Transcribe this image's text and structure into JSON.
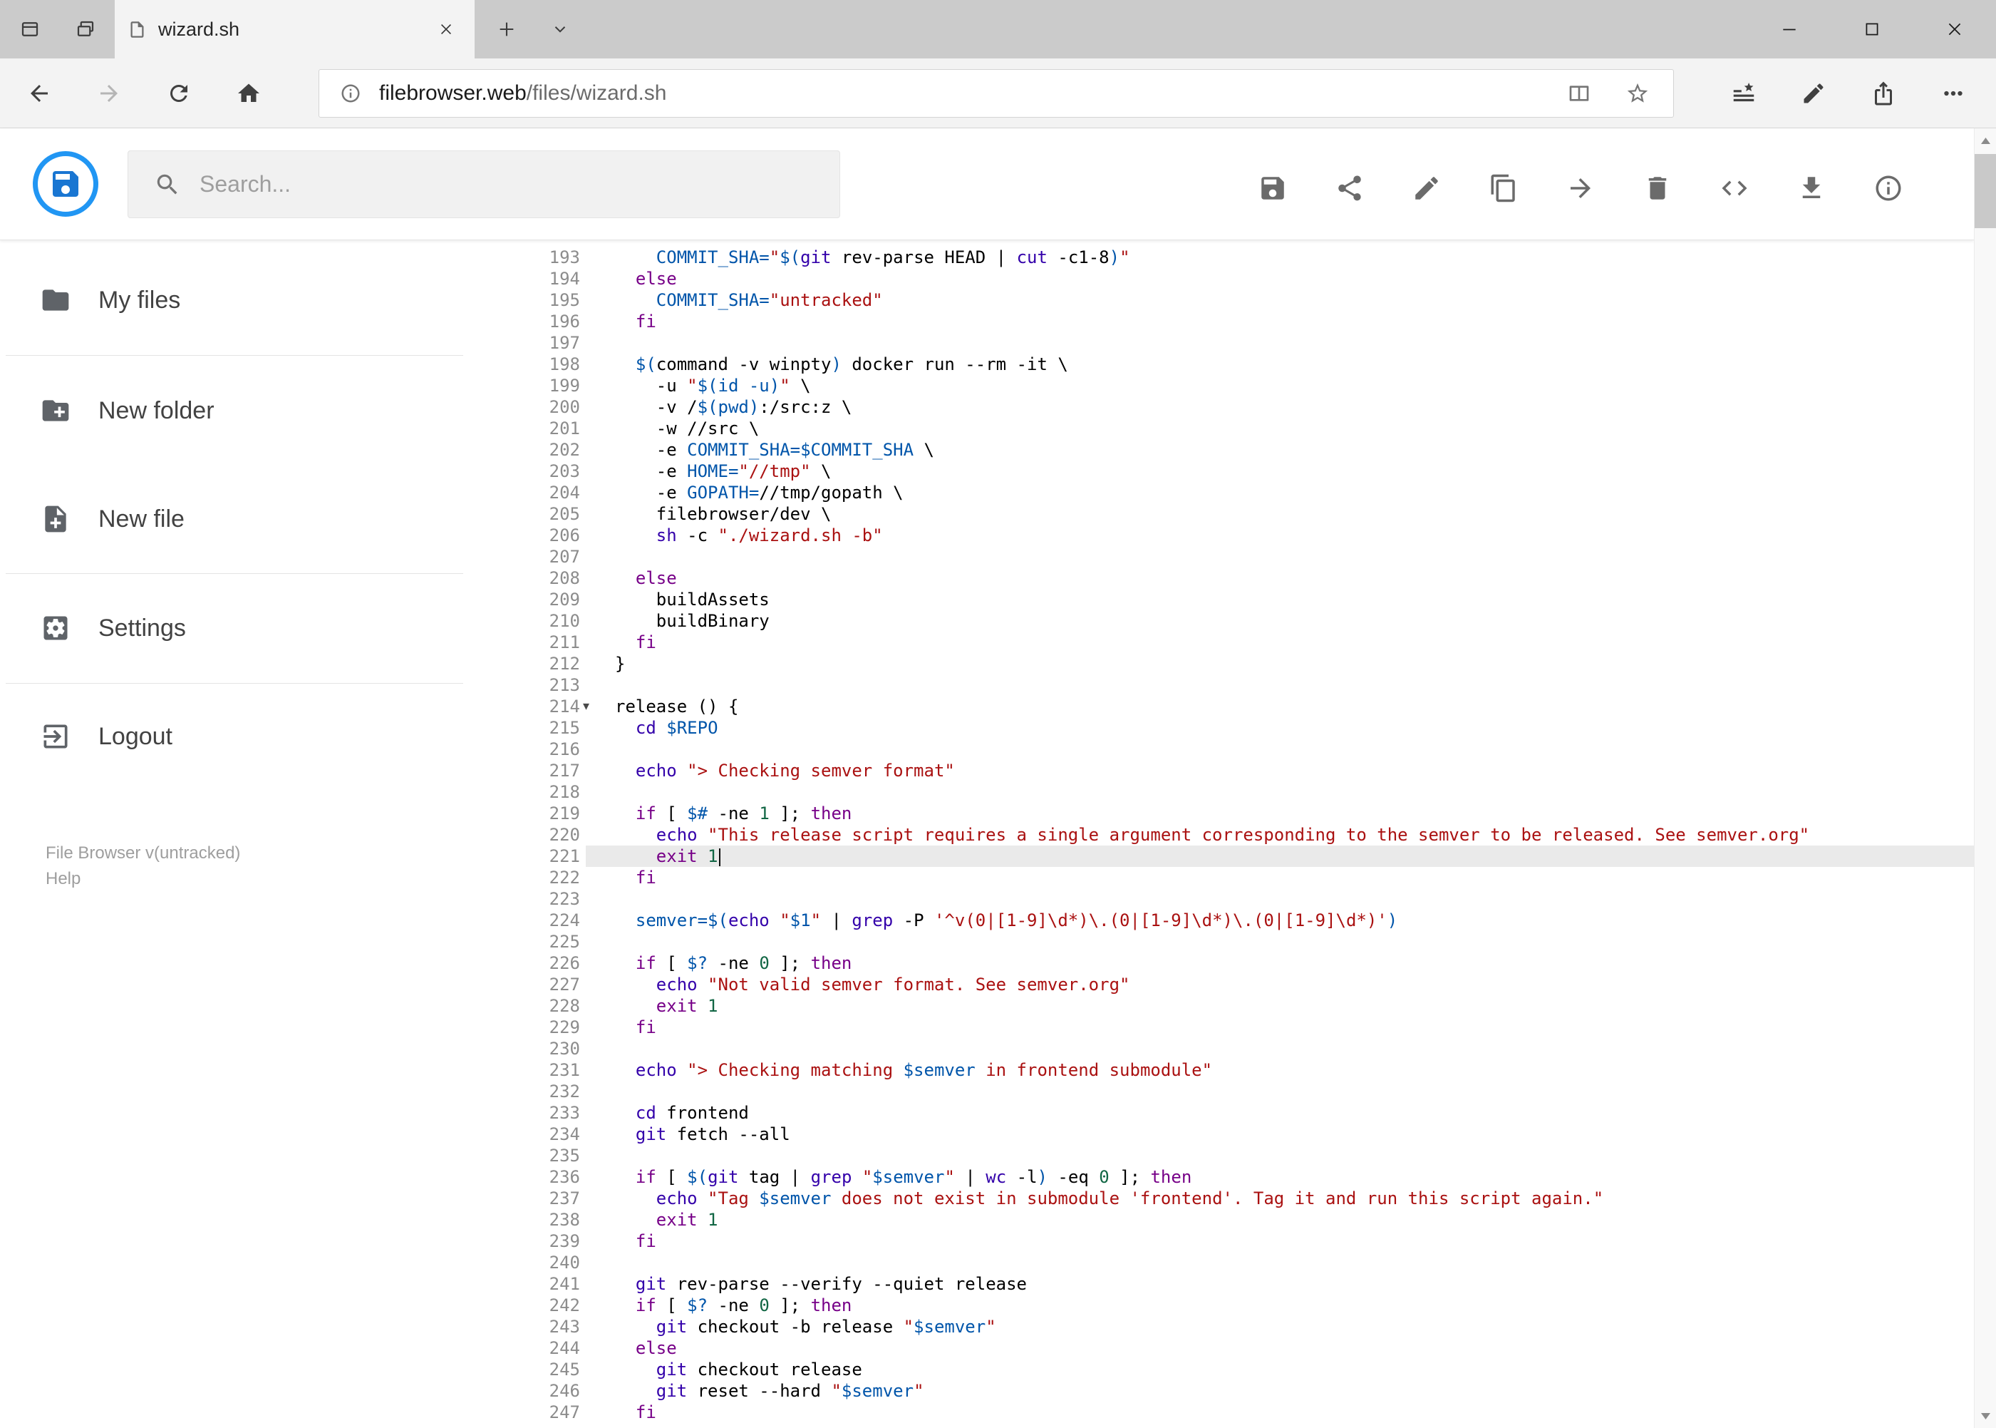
{
  "browser": {
    "tab_title": "wizard.sh",
    "url": {
      "host": "filebrowser.web",
      "path": "/files/wizard.sh"
    },
    "window_control_icons": [
      "minimize",
      "maximize",
      "close"
    ],
    "nav_icons": [
      "back",
      "forward",
      "refresh",
      "home"
    ],
    "urlbox_icons": [
      "site-info",
      "reading-view",
      "favorite-star"
    ],
    "action_icons": [
      "hub",
      "notes-pen",
      "share",
      "more-ellipsis"
    ]
  },
  "app": {
    "search_placeholder": "Search...",
    "toolbar_icons": [
      "save",
      "share",
      "rename",
      "copy",
      "move",
      "delete",
      "code",
      "download",
      "info"
    ],
    "accent_color": "#2196f3",
    "sidebar": {
      "items": [
        {
          "label": "My files",
          "icon": "folder"
        },
        {
          "label": "New folder",
          "icon": "create-new-folder"
        },
        {
          "label": "New file",
          "icon": "note-add"
        },
        {
          "label": "Settings",
          "icon": "settings"
        },
        {
          "label": "Logout",
          "icon": "logout"
        }
      ],
      "footer": {
        "version": "File Browser v(untracked)",
        "help": "Help"
      }
    }
  },
  "editor": {
    "first_line": 193,
    "active_line": 221,
    "fold_marker_line": 214,
    "fold_glyph": "▾",
    "palette": {
      "pl": "#000000",
      "kw": "#770088",
      "bi": "#3300aa",
      "st": "#aa1111",
      "va": "#0055aa",
      "nu": "#116644"
    },
    "lines": [
      [
        [
          "pl",
          "    "
        ],
        [
          "va",
          "COMMIT_SHA="
        ],
        [
          "st",
          "\""
        ],
        [
          "va",
          "$("
        ],
        [
          "bi",
          "git"
        ],
        [
          "pl",
          " rev-parse HEAD | "
        ],
        [
          "bi",
          "cut"
        ],
        [
          "pl",
          " -c1-8"
        ],
        [
          "va",
          ")"
        ],
        [
          "st",
          "\""
        ]
      ],
      [
        [
          "pl",
          "  "
        ],
        [
          "kw",
          "else"
        ]
      ],
      [
        [
          "pl",
          "    "
        ],
        [
          "va",
          "COMMIT_SHA="
        ],
        [
          "st",
          "\"untracked\""
        ]
      ],
      [
        [
          "pl",
          "  "
        ],
        [
          "kw",
          "fi"
        ]
      ],
      [],
      [
        [
          "pl",
          "  "
        ],
        [
          "va",
          "$("
        ],
        [
          "pl",
          "command -v winpty"
        ],
        [
          "va",
          ")"
        ],
        [
          "pl",
          " docker run --rm -it \\"
        ]
      ],
      [
        [
          "pl",
          "    -u "
        ],
        [
          "st",
          "\""
        ],
        [
          "va",
          "$(id -u)"
        ],
        [
          "st",
          "\""
        ],
        [
          "pl",
          " \\"
        ]
      ],
      [
        [
          "pl",
          "    -v /"
        ],
        [
          "va",
          "$(pwd)"
        ],
        [
          "pl",
          ":/src:z \\"
        ]
      ],
      [
        [
          "pl",
          "    -w //src \\"
        ]
      ],
      [
        [
          "pl",
          "    -e "
        ],
        [
          "va",
          "COMMIT_SHA=$COMMIT_SHA"
        ],
        [
          "pl",
          " \\"
        ]
      ],
      [
        [
          "pl",
          "    -e "
        ],
        [
          "va",
          "HOME="
        ],
        [
          "st",
          "\"//tmp\""
        ],
        [
          "pl",
          " \\"
        ]
      ],
      [
        [
          "pl",
          "    -e "
        ],
        [
          "va",
          "GOPATH="
        ],
        [
          "pl",
          "//tmp/gopath \\"
        ]
      ],
      [
        [
          "pl",
          "    filebrowser/dev \\"
        ]
      ],
      [
        [
          "pl",
          "    "
        ],
        [
          "bi",
          "sh"
        ],
        [
          "pl",
          " -c "
        ],
        [
          "st",
          "\"./wizard.sh -b\""
        ]
      ],
      [],
      [
        [
          "pl",
          "  "
        ],
        [
          "kw",
          "else"
        ]
      ],
      [
        [
          "pl",
          "    buildAssets"
        ]
      ],
      [
        [
          "pl",
          "    buildBinary"
        ]
      ],
      [
        [
          "pl",
          "  "
        ],
        [
          "kw",
          "fi"
        ]
      ],
      [
        [
          "pl",
          "}"
        ]
      ],
      [],
      [
        [
          "pl",
          "release () {"
        ]
      ],
      [
        [
          "pl",
          "  "
        ],
        [
          "bi",
          "cd"
        ],
        [
          "pl",
          " "
        ],
        [
          "va",
          "$REPO"
        ]
      ],
      [],
      [
        [
          "pl",
          "  "
        ],
        [
          "bi",
          "echo"
        ],
        [
          "pl",
          " "
        ],
        [
          "st",
          "\"> Checking semver format\""
        ]
      ],
      [],
      [
        [
          "pl",
          "  "
        ],
        [
          "kw",
          "if"
        ],
        [
          "pl",
          " [ "
        ],
        [
          "va",
          "$#"
        ],
        [
          "pl",
          " -ne "
        ],
        [
          "nu",
          "1"
        ],
        [
          "pl",
          " ]; "
        ],
        [
          "kw",
          "then"
        ]
      ],
      [
        [
          "pl",
          "    "
        ],
        [
          "bi",
          "echo"
        ],
        [
          "pl",
          " "
        ],
        [
          "st",
          "\"This release script requires a single argument corresponding to the semver to be released. See semver.org\""
        ]
      ],
      [
        [
          "pl",
          "    "
        ],
        [
          "kw",
          "exit"
        ],
        [
          "pl",
          " "
        ],
        [
          "nu",
          "1"
        ]
      ],
      [
        [
          "pl",
          "  "
        ],
        [
          "kw",
          "fi"
        ]
      ],
      [],
      [
        [
          "pl",
          "  "
        ],
        [
          "va",
          "semver=$("
        ],
        [
          "bi",
          "echo"
        ],
        [
          "pl",
          " "
        ],
        [
          "st",
          "\""
        ],
        [
          "va",
          "$1"
        ],
        [
          "st",
          "\""
        ],
        [
          "pl",
          " | "
        ],
        [
          "bi",
          "grep"
        ],
        [
          "pl",
          " -P "
        ],
        [
          "st",
          "'^v(0|[1-9]\\d*)\\.(0|[1-9]\\d*)\\.(0|[1-9]\\d*)'"
        ],
        [
          "va",
          ")"
        ]
      ],
      [],
      [
        [
          "pl",
          "  "
        ],
        [
          "kw",
          "if"
        ],
        [
          "pl",
          " [ "
        ],
        [
          "va",
          "$?"
        ],
        [
          "pl",
          " -ne "
        ],
        [
          "nu",
          "0"
        ],
        [
          "pl",
          " ]; "
        ],
        [
          "kw",
          "then"
        ]
      ],
      [
        [
          "pl",
          "    "
        ],
        [
          "bi",
          "echo"
        ],
        [
          "pl",
          " "
        ],
        [
          "st",
          "\"Not valid semver format. See semver.org\""
        ]
      ],
      [
        [
          "pl",
          "    "
        ],
        [
          "kw",
          "exit"
        ],
        [
          "pl",
          " "
        ],
        [
          "nu",
          "1"
        ]
      ],
      [
        [
          "pl",
          "  "
        ],
        [
          "kw",
          "fi"
        ]
      ],
      [],
      [
        [
          "pl",
          "  "
        ],
        [
          "bi",
          "echo"
        ],
        [
          "pl",
          " "
        ],
        [
          "st",
          "\"> Checking matching "
        ],
        [
          "va",
          "$semver"
        ],
        [
          "st",
          " in frontend submodule\""
        ]
      ],
      [],
      [
        [
          "pl",
          "  "
        ],
        [
          "bi",
          "cd"
        ],
        [
          "pl",
          " frontend"
        ]
      ],
      [
        [
          "pl",
          "  "
        ],
        [
          "bi",
          "git"
        ],
        [
          "pl",
          " fetch --all"
        ]
      ],
      [],
      [
        [
          "pl",
          "  "
        ],
        [
          "kw",
          "if"
        ],
        [
          "pl",
          " [ "
        ],
        [
          "va",
          "$("
        ],
        [
          "bi",
          "git"
        ],
        [
          "pl",
          " tag | "
        ],
        [
          "bi",
          "grep"
        ],
        [
          "pl",
          " "
        ],
        [
          "st",
          "\""
        ],
        [
          "va",
          "$semver"
        ],
        [
          "st",
          "\""
        ],
        [
          "pl",
          " | "
        ],
        [
          "bi",
          "wc"
        ],
        [
          "pl",
          " -l"
        ],
        [
          "va",
          ")"
        ],
        [
          "pl",
          " -eq "
        ],
        [
          "nu",
          "0"
        ],
        [
          "pl",
          " ]; "
        ],
        [
          "kw",
          "then"
        ]
      ],
      [
        [
          "pl",
          "    "
        ],
        [
          "bi",
          "echo"
        ],
        [
          "pl",
          " "
        ],
        [
          "st",
          "\"Tag "
        ],
        [
          "va",
          "$semver"
        ],
        [
          "st",
          " does not exist in submodule 'frontend'. Tag it and run this script again.\""
        ]
      ],
      [
        [
          "pl",
          "    "
        ],
        [
          "kw",
          "exit"
        ],
        [
          "pl",
          " "
        ],
        [
          "nu",
          "1"
        ]
      ],
      [
        [
          "pl",
          "  "
        ],
        [
          "kw",
          "fi"
        ]
      ],
      [],
      [
        [
          "pl",
          "  "
        ],
        [
          "bi",
          "git"
        ],
        [
          "pl",
          " rev-parse --verify --quiet release"
        ]
      ],
      [
        [
          "pl",
          "  "
        ],
        [
          "kw",
          "if"
        ],
        [
          "pl",
          " [ "
        ],
        [
          "va",
          "$?"
        ],
        [
          "pl",
          " -ne "
        ],
        [
          "nu",
          "0"
        ],
        [
          "pl",
          " ]; "
        ],
        [
          "kw",
          "then"
        ]
      ],
      [
        [
          "pl",
          "    "
        ],
        [
          "bi",
          "git"
        ],
        [
          "pl",
          " checkout -b release "
        ],
        [
          "st",
          "\""
        ],
        [
          "va",
          "$semver"
        ],
        [
          "st",
          "\""
        ]
      ],
      [
        [
          "pl",
          "  "
        ],
        [
          "kw",
          "else"
        ]
      ],
      [
        [
          "pl",
          "    "
        ],
        [
          "bi",
          "git"
        ],
        [
          "pl",
          " checkout release"
        ]
      ],
      [
        [
          "pl",
          "    "
        ],
        [
          "bi",
          "git"
        ],
        [
          "pl",
          " reset --hard "
        ],
        [
          "st",
          "\""
        ],
        [
          "va",
          "$semver"
        ],
        [
          "st",
          "\""
        ]
      ],
      [
        [
          "pl",
          "  "
        ],
        [
          "kw",
          "fi"
        ]
      ]
    ]
  }
}
